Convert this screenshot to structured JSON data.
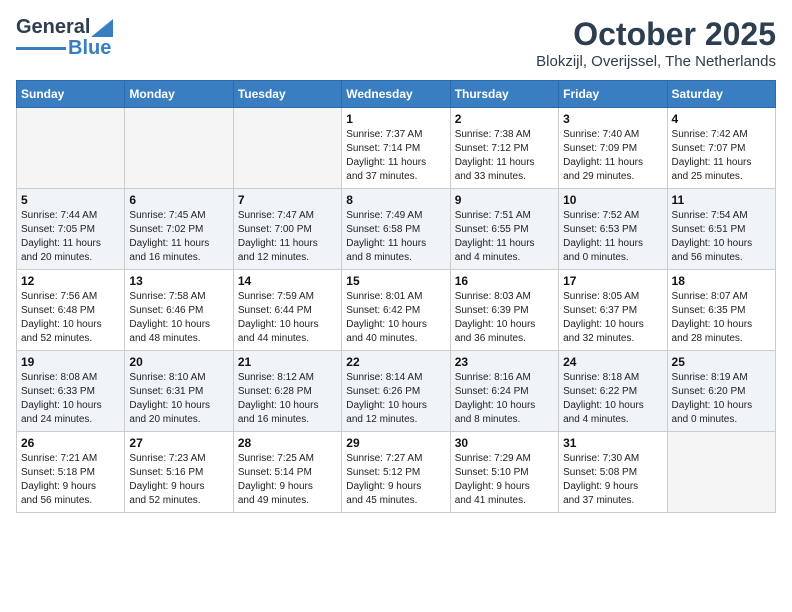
{
  "logo": {
    "part1": "General",
    "part2": "Blue"
  },
  "title": "October 2025",
  "subtitle": "Blokzijl, Overijssel, The Netherlands",
  "weekdays": [
    "Sunday",
    "Monday",
    "Tuesday",
    "Wednesday",
    "Thursday",
    "Friday",
    "Saturday"
  ],
  "weeks": [
    [
      {
        "day": "",
        "info": ""
      },
      {
        "day": "",
        "info": ""
      },
      {
        "day": "",
        "info": ""
      },
      {
        "day": "1",
        "info": "Sunrise: 7:37 AM\nSunset: 7:14 PM\nDaylight: 11 hours\nand 37 minutes."
      },
      {
        "day": "2",
        "info": "Sunrise: 7:38 AM\nSunset: 7:12 PM\nDaylight: 11 hours\nand 33 minutes."
      },
      {
        "day": "3",
        "info": "Sunrise: 7:40 AM\nSunset: 7:09 PM\nDaylight: 11 hours\nand 29 minutes."
      },
      {
        "day": "4",
        "info": "Sunrise: 7:42 AM\nSunset: 7:07 PM\nDaylight: 11 hours\nand 25 minutes."
      }
    ],
    [
      {
        "day": "5",
        "info": "Sunrise: 7:44 AM\nSunset: 7:05 PM\nDaylight: 11 hours\nand 20 minutes."
      },
      {
        "day": "6",
        "info": "Sunrise: 7:45 AM\nSunset: 7:02 PM\nDaylight: 11 hours\nand 16 minutes."
      },
      {
        "day": "7",
        "info": "Sunrise: 7:47 AM\nSunset: 7:00 PM\nDaylight: 11 hours\nand 12 minutes."
      },
      {
        "day": "8",
        "info": "Sunrise: 7:49 AM\nSunset: 6:58 PM\nDaylight: 11 hours\nand 8 minutes."
      },
      {
        "day": "9",
        "info": "Sunrise: 7:51 AM\nSunset: 6:55 PM\nDaylight: 11 hours\nand 4 minutes."
      },
      {
        "day": "10",
        "info": "Sunrise: 7:52 AM\nSunset: 6:53 PM\nDaylight: 11 hours\nand 0 minutes."
      },
      {
        "day": "11",
        "info": "Sunrise: 7:54 AM\nSunset: 6:51 PM\nDaylight: 10 hours\nand 56 minutes."
      }
    ],
    [
      {
        "day": "12",
        "info": "Sunrise: 7:56 AM\nSunset: 6:48 PM\nDaylight: 10 hours\nand 52 minutes."
      },
      {
        "day": "13",
        "info": "Sunrise: 7:58 AM\nSunset: 6:46 PM\nDaylight: 10 hours\nand 48 minutes."
      },
      {
        "day": "14",
        "info": "Sunrise: 7:59 AM\nSunset: 6:44 PM\nDaylight: 10 hours\nand 44 minutes."
      },
      {
        "day": "15",
        "info": "Sunrise: 8:01 AM\nSunset: 6:42 PM\nDaylight: 10 hours\nand 40 minutes."
      },
      {
        "day": "16",
        "info": "Sunrise: 8:03 AM\nSunset: 6:39 PM\nDaylight: 10 hours\nand 36 minutes."
      },
      {
        "day": "17",
        "info": "Sunrise: 8:05 AM\nSunset: 6:37 PM\nDaylight: 10 hours\nand 32 minutes."
      },
      {
        "day": "18",
        "info": "Sunrise: 8:07 AM\nSunset: 6:35 PM\nDaylight: 10 hours\nand 28 minutes."
      }
    ],
    [
      {
        "day": "19",
        "info": "Sunrise: 8:08 AM\nSunset: 6:33 PM\nDaylight: 10 hours\nand 24 minutes."
      },
      {
        "day": "20",
        "info": "Sunrise: 8:10 AM\nSunset: 6:31 PM\nDaylight: 10 hours\nand 20 minutes."
      },
      {
        "day": "21",
        "info": "Sunrise: 8:12 AM\nSunset: 6:28 PM\nDaylight: 10 hours\nand 16 minutes."
      },
      {
        "day": "22",
        "info": "Sunrise: 8:14 AM\nSunset: 6:26 PM\nDaylight: 10 hours\nand 12 minutes."
      },
      {
        "day": "23",
        "info": "Sunrise: 8:16 AM\nSunset: 6:24 PM\nDaylight: 10 hours\nand 8 minutes."
      },
      {
        "day": "24",
        "info": "Sunrise: 8:18 AM\nSunset: 6:22 PM\nDaylight: 10 hours\nand 4 minutes."
      },
      {
        "day": "25",
        "info": "Sunrise: 8:19 AM\nSunset: 6:20 PM\nDaylight: 10 hours\nand 0 minutes."
      }
    ],
    [
      {
        "day": "26",
        "info": "Sunrise: 7:21 AM\nSunset: 5:18 PM\nDaylight: 9 hours\nand 56 minutes."
      },
      {
        "day": "27",
        "info": "Sunrise: 7:23 AM\nSunset: 5:16 PM\nDaylight: 9 hours\nand 52 minutes."
      },
      {
        "day": "28",
        "info": "Sunrise: 7:25 AM\nSunset: 5:14 PM\nDaylight: 9 hours\nand 49 minutes."
      },
      {
        "day": "29",
        "info": "Sunrise: 7:27 AM\nSunset: 5:12 PM\nDaylight: 9 hours\nand 45 minutes."
      },
      {
        "day": "30",
        "info": "Sunrise: 7:29 AM\nSunset: 5:10 PM\nDaylight: 9 hours\nand 41 minutes."
      },
      {
        "day": "31",
        "info": "Sunrise: 7:30 AM\nSunset: 5:08 PM\nDaylight: 9 hours\nand 37 minutes."
      },
      {
        "day": "",
        "info": ""
      }
    ]
  ]
}
